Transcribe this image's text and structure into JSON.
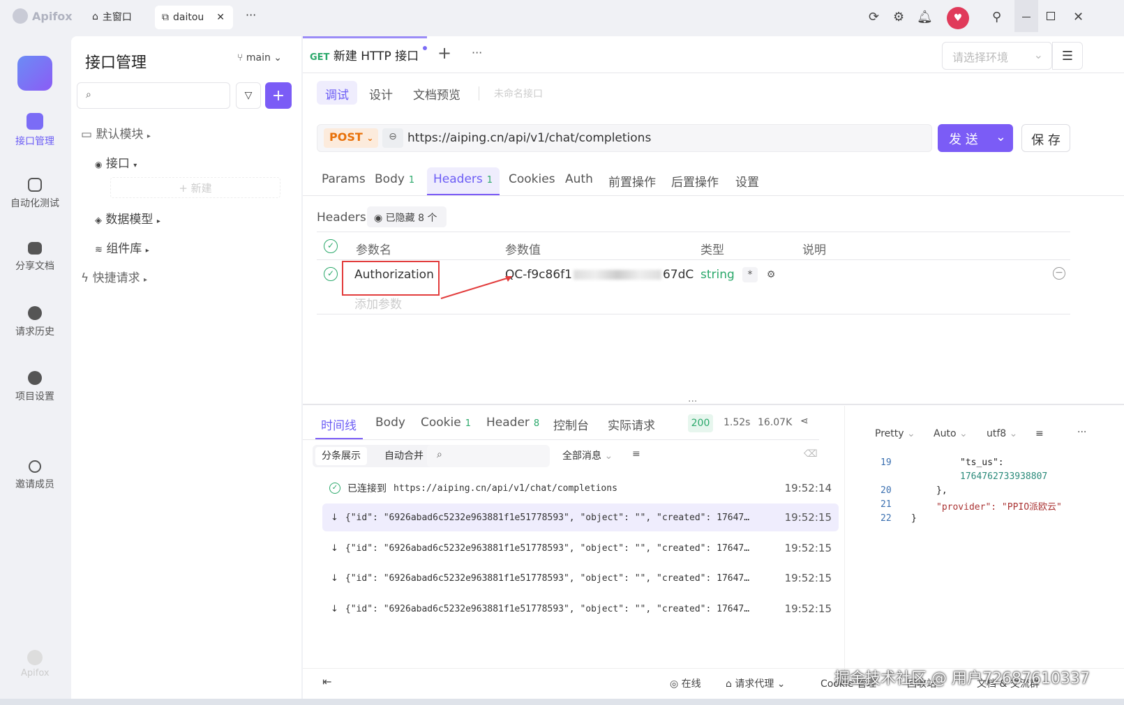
{
  "titlebar": {
    "app_name": "Apifox",
    "tabs": [
      {
        "label": "主窗口",
        "icon": "home-icon"
      },
      {
        "label": "daitou",
        "icon": "external-link-icon"
      }
    ],
    "more": "···"
  },
  "leftnav": {
    "items": [
      {
        "label": "接口管理",
        "icon": "api-icon"
      },
      {
        "label": "自动化测试",
        "icon": "automation-icon"
      },
      {
        "label": "分享文档",
        "icon": "book-icon"
      },
      {
        "label": "请求历史",
        "icon": "clock-icon"
      },
      {
        "label": "项目设置",
        "icon": "gear-icon"
      },
      {
        "label": "邀请成员",
        "icon": "add-user-icon"
      }
    ],
    "footer_logo": "Apifox"
  },
  "sidebar": {
    "title": "接口管理",
    "branch": "main",
    "search_placeholder": "",
    "tree": [
      {
        "label": "默认模块",
        "level": 0
      },
      {
        "label": "接口",
        "level": 1
      },
      {
        "label": "+ 新建",
        "level": 2
      },
      {
        "label": "数据模型",
        "level": 1
      },
      {
        "label": "组件库",
        "level": 1
      },
      {
        "label": "快捷请求",
        "level": 0
      }
    ]
  },
  "request_tab": {
    "method": "GET",
    "title": "新建 HTTP 接口",
    "add": "+",
    "more": "···",
    "env_placeholder": "请选择环境"
  },
  "mode_tabs": [
    "调试",
    "设计",
    "文档预览"
  ],
  "unnamed": "未命名接口",
  "url_bar": {
    "method": "POST",
    "url": "https://aiping.cn/api/v1/chat/completions",
    "send": "发 送",
    "save": "保 存"
  },
  "param_tabs": [
    {
      "label": "Params",
      "count": ""
    },
    {
      "label": "Body",
      "count": "1"
    },
    {
      "label": "Headers",
      "count": "1"
    },
    {
      "label": "Cookies",
      "count": ""
    },
    {
      "label": "Auth",
      "count": ""
    },
    {
      "label": "前置操作",
      "count": ""
    },
    {
      "label": "后置操作",
      "count": ""
    },
    {
      "label": "设置",
      "count": ""
    }
  ],
  "headers_section": {
    "title": "Headers",
    "hidden": "已隐藏 8 个",
    "columns": [
      "参数名",
      "参数值",
      "类型",
      "说明"
    ],
    "row": {
      "name": "Authorization",
      "value_start": "QC-f9c86f1",
      "value_end": "67dC",
      "type": "string",
      "required": "*"
    },
    "add_param": "添加参数"
  },
  "response_tabs": [
    {
      "label": "时间线",
      "count": ""
    },
    {
      "label": "Body",
      "count": ""
    },
    {
      "label": "Cookie",
      "count": "1"
    },
    {
      "label": "Header",
      "count": "8"
    },
    {
      "label": "控制台",
      "count": ""
    },
    {
      "label": "实际请求",
      "count": ""
    }
  ],
  "response_meta": {
    "status": "200",
    "time": "1.52s",
    "size": "16.07K"
  },
  "timeline_controls": {
    "split": "分条展示",
    "merge": "自动合并",
    "filter": "全部消息"
  },
  "timeline": [
    {
      "icon": "check-circle-icon",
      "text_label": "已连接到",
      "text": "https://aiping.cn/api/v1/chat/completions",
      "time": "19:52:14"
    },
    {
      "icon": "arrow-down-icon",
      "text": "{\"id\": \"6926abad6c5232e963881f1e51778593\", \"object\": \"\", \"created\": 17647…",
      "time": "19:52:15"
    },
    {
      "icon": "arrow-down-icon",
      "text": "{\"id\": \"6926abad6c5232e963881f1e51778593\", \"object\": \"\", \"created\": 17647…",
      "time": "19:52:15"
    },
    {
      "icon": "arrow-down-icon",
      "text": "{\"id\": \"6926abad6c5232e963881f1e51778593\", \"object\": \"\", \"created\": 17647…",
      "time": "19:52:15"
    },
    {
      "icon": "arrow-down-icon",
      "text": "{\"id\": \"6926abad6c5232e963881f1e51778593\", \"object\": \"\", \"created\": 17647…",
      "time": "19:52:15"
    }
  ],
  "viewer": {
    "format": "Pretty",
    "mode": "Auto",
    "encoding": "utf8",
    "lines": [
      {
        "num": "19",
        "text": "\"ts_us\":"
      },
      {
        "num": "",
        "text": "1764762733938807"
      },
      {
        "num": "20",
        "text": "},"
      },
      {
        "num": "21",
        "text": "\"provider\": \"PPIO派欧云\""
      },
      {
        "num": "22",
        "text": "}"
      }
    ]
  },
  "statusbar": {
    "online": "在线",
    "proxy": "请求代理",
    "cookie": "Cookie 管理",
    "recycle": "回收站",
    "docs": "文档 & 交流群"
  },
  "watermark": "掘金技术社区 @ 用户72687610337",
  "colors": {
    "accent": "#6b5cf5",
    "post": "#e8710a",
    "get": "#2aa86a",
    "annotation": "#e23c3c"
  }
}
